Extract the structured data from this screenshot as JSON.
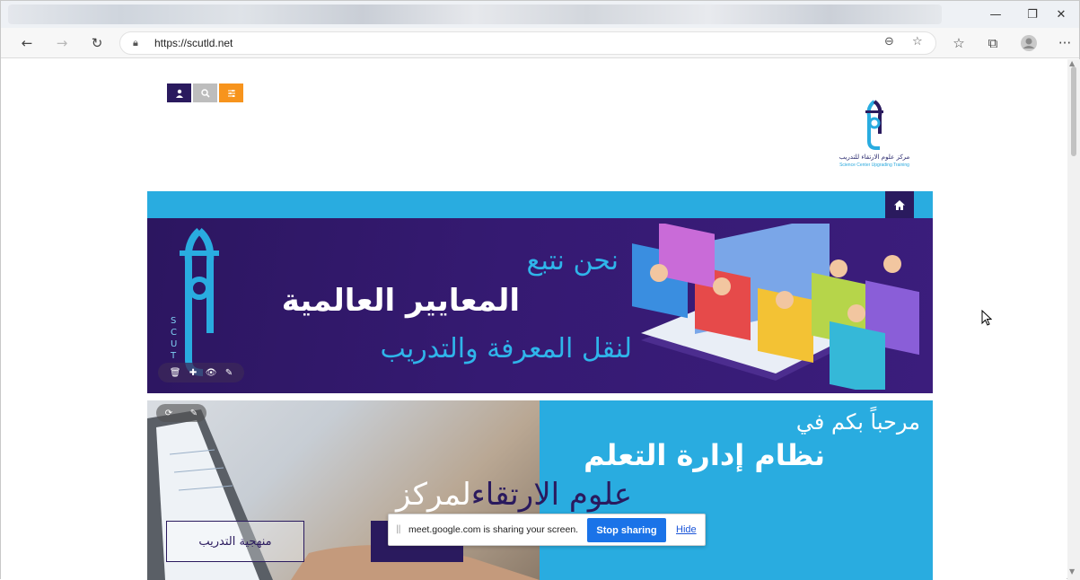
{
  "browser": {
    "address": "https://scutld.net",
    "window_controls": {
      "minimize": "—",
      "restore": "❐",
      "close": "✕"
    }
  },
  "site": {
    "logo": {
      "arabic": "مركز علوم الارتقاء للتدريب",
      "english": "Science Center Upgrading Training"
    },
    "banner1": {
      "line1": "نحن نتبع",
      "line2": "المعايير العالمية",
      "line3": "لنقل المعرفة والتدريب",
      "brand_vertical": "SCUT"
    },
    "banner2": {
      "line1": "مرحباً بكم في",
      "line2": "نظام إدارة التعلم",
      "line3_dark": "علوم الارتقاء",
      "line3_light": "لمركز",
      "button_outline": "منهجية التدريب"
    }
  },
  "screen_share": {
    "message": "meet.google.com is sharing your screen.",
    "stop_label": "Stop sharing",
    "hide_label": "Hide"
  },
  "colors": {
    "brand_purple": "#2a1a5e",
    "brand_blue": "#29ace0",
    "accent_orange": "#f7941d"
  }
}
